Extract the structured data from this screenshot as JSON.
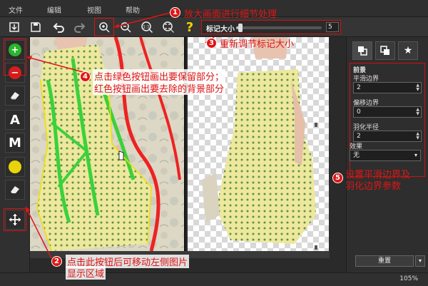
{
  "menu": [
    "文件",
    "编辑",
    "视图",
    "帮助"
  ],
  "toolbar": {
    "marker_size_label": "标记大小",
    "marker_size_value": "5",
    "marker_size_fraction": 0.05,
    "zoom_1to1": "1:1",
    "help_glyph": "?"
  },
  "left_tools": {
    "letter_a": "A",
    "letter_m": "M",
    "keep_color": "#2bb52b",
    "remove_color": "#d61d1d",
    "fill_color": "#e8d40a"
  },
  "right_panel": {
    "section_title": "前景",
    "smooth_label": "平滑边界",
    "smooth_value": "2",
    "offset_label": "偏移边界",
    "offset_value": "0",
    "feather_label": "羽化半径",
    "feather_value": "2",
    "effect_label": "效果",
    "effect_value": "无",
    "reset_label": "重置"
  },
  "status": {
    "zoom": "105%"
  },
  "annotations": {
    "a1": {
      "num": "1",
      "text": "放大画面进行细节处理"
    },
    "a2": {
      "num": "2",
      "text_line1": "点击此按钮后可移动左侧图片",
      "text_line2": "显示区域"
    },
    "a3": {
      "num": "3",
      "text": "重新调节标记大小"
    },
    "a4": {
      "num": "4",
      "text_line1": "点击绿色按钮画出要保留部分；",
      "text_line2": "红色按钮画出要去除的背景部分"
    },
    "a5": {
      "num": "5",
      "text_line1": "设置平滑边界及",
      "text_line2": "羽化边界参数"
    }
  },
  "colors": {
    "annotation_red": "#e01515",
    "keep_green": "#2bb52b",
    "remove_red": "#d61d1d"
  }
}
